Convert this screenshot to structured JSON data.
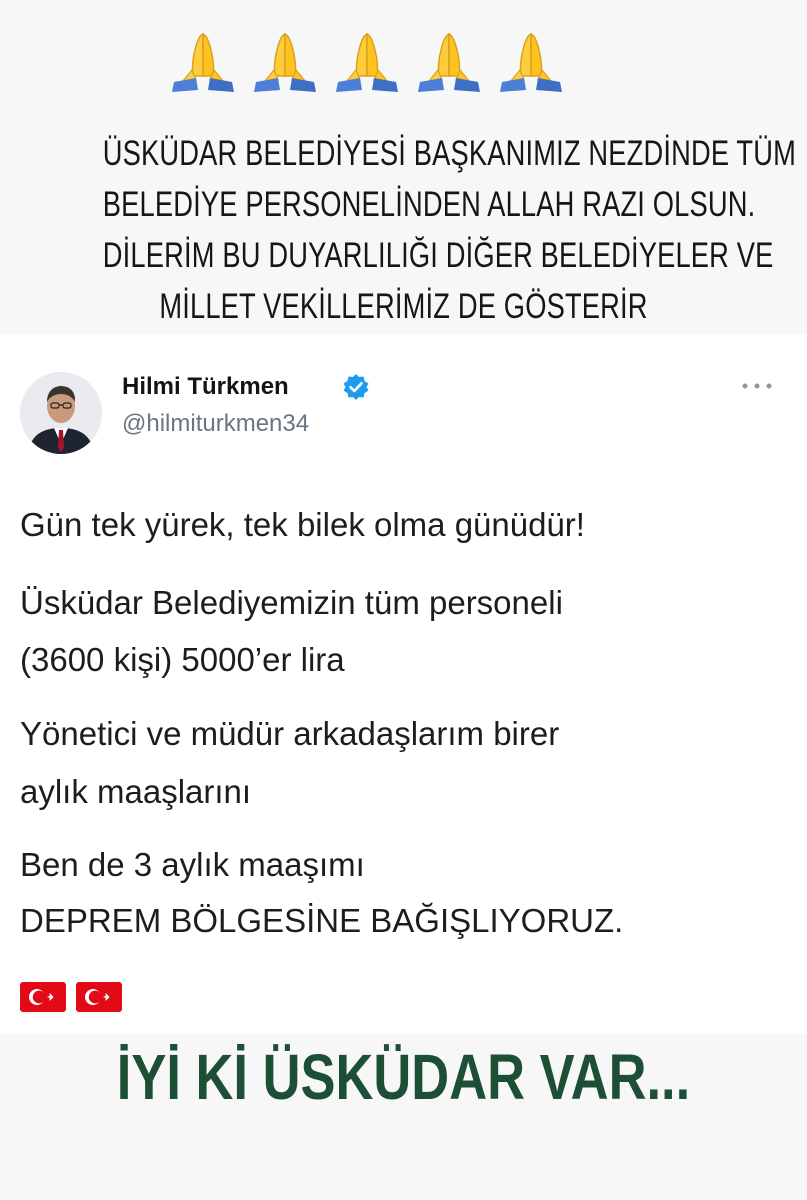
{
  "story": {
    "emoji_count": 5,
    "caption_lines": [
      "ÜSKÜDAR BELEDİYESİ BAŞKANIMIZ NEZDİNDE TÜM",
      "BELEDİYE PERSONELİNDEN ALLAH RAZI OLSUN.",
      "DİLERİM BU DUYARLILIĞI DİĞER BELEDİYELER VE",
      "MİLLET VEKİLLERİMİZ DE GÖSTERİR"
    ],
    "footer_slogan": "İYİ Kİ ÜSKÜDAR VAR..."
  },
  "tweet": {
    "author_name": "Hilmi Türkmen",
    "author_handle": "@hilmiturkmen34",
    "verified": true,
    "lines": [
      "Gün tek yürek, tek bilek olma günüdür!",
      "Üsküdar Belediyemizin tüm personeli",
      "(3600 kişi) 5000’er lira",
      "Yönetici ve müdür arkadaşlarım birer",
      "aylık maaşlarını",
      "Ben de 3 aylık maaşımı",
      "DEPREM BÖLGESİNE BAĞIŞLIYORUZ."
    ],
    "flag_count": 2
  },
  "colors": {
    "background": "#f7f7f7",
    "card": "#ffffff",
    "verified_blue": "#1d9bf0",
    "slogan_green": "#1c4f35",
    "flag_red": "#e30a17"
  },
  "icons": [
    "folded-hands-icon",
    "verified-badge-icon",
    "more-options-icon",
    "turkey-flag-icon"
  ]
}
